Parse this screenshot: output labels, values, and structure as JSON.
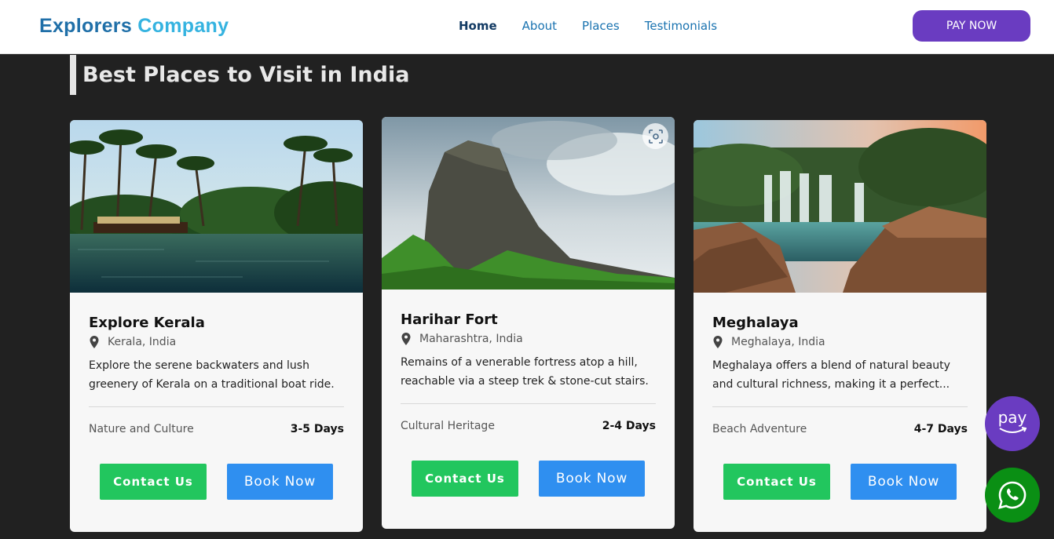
{
  "brand": {
    "part1": "Explorers",
    "part2": "Company"
  },
  "nav": {
    "items": [
      "Home",
      "About",
      "Places",
      "Testimonials"
    ],
    "active": "Home"
  },
  "header": {
    "pay_now_label": "PAY NOW"
  },
  "section": {
    "title": "Best Places to Visit in India"
  },
  "cards": [
    {
      "title": "Explore Kerala",
      "location": "Kerala, India",
      "description": "Explore the serene backwaters and lush greenery of Kerala on a traditional boat ride.",
      "category": "Nature and Culture",
      "duration": "3-5 Days",
      "contact_label": "Contact Us",
      "book_label": "Book Now",
      "image_icon": "kerala-backwaters-image"
    },
    {
      "title": "Harihar Fort",
      "location": "Maharashtra, India",
      "description": "Remains of a venerable fortress atop a hill, reachable via a steep trek & stone-cut stairs.",
      "category": "Cultural Heritage",
      "duration": "2-4 Days",
      "contact_label": "Contact Us",
      "book_label": "Book Now",
      "image_icon": "harihar-fort-image"
    },
    {
      "title": "Meghalaya",
      "location": "Meghalaya, India",
      "description": "Meghalaya offers a blend of natural beauty and cultural richness, making it a perfect...",
      "category": "Beach Adventure",
      "duration": "4-7 Days",
      "contact_label": "Contact Us",
      "book_label": "Book Now",
      "image_icon": "meghalaya-waterfall-image"
    }
  ],
  "floating": {
    "pay_label": "pay",
    "pay_icon": "amazon-pay-icon",
    "whatsapp_icon": "whatsapp-icon"
  },
  "colors": {
    "brand_dark": "#1f6fa8",
    "brand_light": "#35b3e0",
    "accent_purple": "#6a3cc1",
    "contact_green": "#22c65e",
    "book_blue": "#2f8ff0",
    "whatsapp_green": "#0a8f14"
  }
}
